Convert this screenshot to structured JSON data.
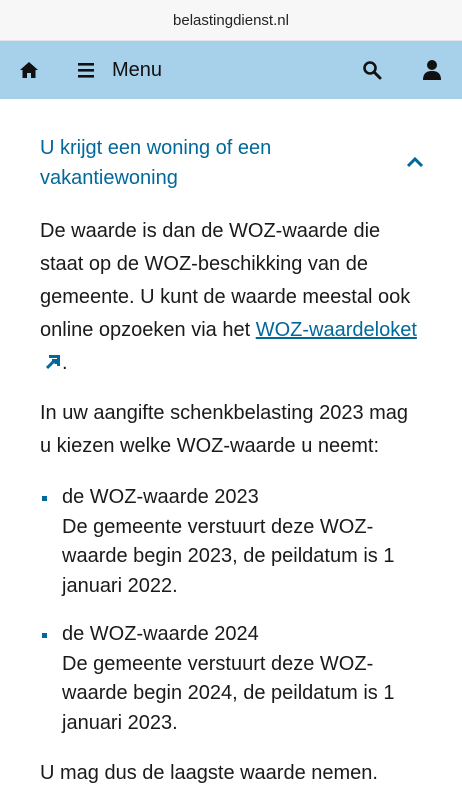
{
  "browser": {
    "url": "belastingdienst.nl"
  },
  "nav": {
    "menu_label": "Menu"
  },
  "accordion": {
    "title": "U krijgt een woning of een vakantiewoning",
    "paragraph1_text": "De waarde is dan de WOZ-waarde die staat op de WOZ-beschikking van de gemeente. U kunt de waarde meestal ook online opzoeken via het ",
    "paragraph1_link": "WOZ-waardeloket",
    "paragraph1_end": ".",
    "paragraph2": "In uw aangifte schenkbelasting 2023 mag u kiezen welke WOZ-waarde u neemt:",
    "items": [
      {
        "title": "de WOZ-waarde 2023",
        "body": "De gemeente verstuurt deze WOZ-waarde begin 2023, de peildatum is 1 januari 2022."
      },
      {
        "title": "de WOZ-waarde 2024",
        "body": "De gemeente verstuurt deze WOZ-waarde begin 2024, de peildatum is 1 januari 2023."
      }
    ],
    "paragraph3": "U mag dus de laagste waarde nemen."
  },
  "colors": {
    "nav_bg": "#a7d1ea",
    "link": "#01689b"
  }
}
